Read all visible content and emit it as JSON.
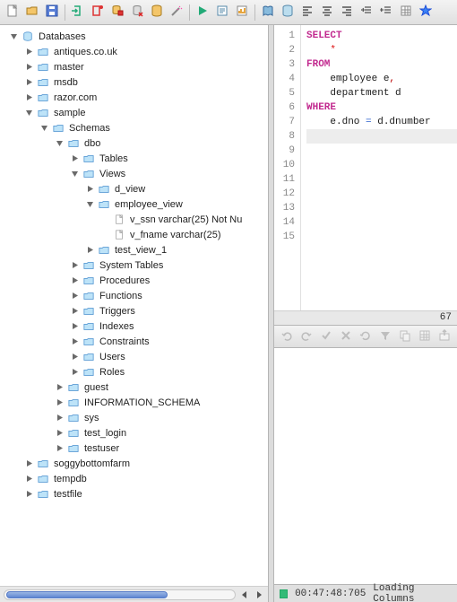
{
  "toolbar": {
    "icons": [
      "new-file-icon",
      "open-icon",
      "save-icon",
      "sep",
      "conn-in-icon",
      "conn-out-icon",
      "db-copy-icon",
      "db-del-icon",
      "db-icon",
      "wand-icon",
      "sep",
      "run-icon",
      "explain-icon",
      "analyze-icon",
      "sep",
      "book-icon",
      "db2-icon",
      "align-left-icon",
      "align-center-icon",
      "align-right-icon",
      "indent-icon",
      "outdent-icon",
      "grid-icon",
      "star-icon"
    ]
  },
  "tree": {
    "root": {
      "label": "Databases",
      "icon": "db-tree-icon",
      "expanded": true,
      "children": [
        {
          "label": "antiques.co.uk",
          "icon": "folder-icon",
          "expanded": false,
          "children": []
        },
        {
          "label": "master",
          "icon": "folder-icon",
          "expanded": false,
          "children": []
        },
        {
          "label": "msdb",
          "icon": "folder-icon",
          "expanded": false,
          "children": []
        },
        {
          "label": "razor.com",
          "icon": "folder-icon",
          "expanded": false,
          "children": []
        },
        {
          "label": "sample",
          "icon": "folder-icon",
          "expanded": true,
          "children": [
            {
              "label": "Schemas",
              "icon": "folder-icon",
              "expanded": true,
              "children": [
                {
                  "label": "dbo",
                  "icon": "folder-icon",
                  "expanded": true,
                  "children": [
                    {
                      "label": "Tables",
                      "icon": "folder-icon",
                      "expanded": false,
                      "children": []
                    },
                    {
                      "label": "Views",
                      "icon": "folder-icon",
                      "expanded": true,
                      "children": [
                        {
                          "label": "d_view",
                          "icon": "folder-icon",
                          "expanded": false,
                          "children": []
                        },
                        {
                          "label": "employee_view",
                          "icon": "folder-icon",
                          "expanded": true,
                          "children": [
                            {
                              "label": "v_ssn varchar(25) Not Nu",
                              "icon": "file-icon",
                              "leaf": true
                            },
                            {
                              "label": "v_fname varchar(25)",
                              "icon": "file-icon",
                              "leaf": true
                            }
                          ]
                        },
                        {
                          "label": "test_view_1",
                          "icon": "folder-icon",
                          "expanded": false,
                          "children": []
                        }
                      ]
                    },
                    {
                      "label": "System Tables",
                      "icon": "folder-icon",
                      "expanded": false,
                      "children": []
                    },
                    {
                      "label": "Procedures",
                      "icon": "folder-icon",
                      "expanded": false,
                      "children": []
                    },
                    {
                      "label": "Functions",
                      "icon": "folder-icon",
                      "expanded": false,
                      "children": []
                    },
                    {
                      "label": "Triggers",
                      "icon": "folder-icon",
                      "expanded": false,
                      "children": []
                    },
                    {
                      "label": "Indexes",
                      "icon": "folder-icon",
                      "expanded": false,
                      "children": []
                    },
                    {
                      "label": "Constraints",
                      "icon": "folder-icon",
                      "expanded": false,
                      "children": []
                    },
                    {
                      "label": "Users",
                      "icon": "folder-icon",
                      "expanded": false,
                      "children": []
                    },
                    {
                      "label": "Roles",
                      "icon": "folder-icon",
                      "expanded": false,
                      "children": []
                    }
                  ]
                },
                {
                  "label": "guest",
                  "icon": "folder-icon",
                  "expanded": false,
                  "children": []
                },
                {
                  "label": "INFORMATION_SCHEMA",
                  "icon": "folder-icon",
                  "expanded": false,
                  "children": []
                },
                {
                  "label": "sys",
                  "icon": "folder-icon",
                  "expanded": false,
                  "children": []
                },
                {
                  "label": "test_login",
                  "icon": "folder-icon",
                  "expanded": false,
                  "children": []
                },
                {
                  "label": "testuser",
                  "icon": "folder-icon",
                  "expanded": false,
                  "children": []
                }
              ]
            }
          ]
        },
        {
          "label": "soggybottomfarm",
          "icon": "folder-icon",
          "expanded": false,
          "children": []
        },
        {
          "label": "tempdb",
          "icon": "folder-icon",
          "expanded": false,
          "children": []
        },
        {
          "label": "testfile",
          "icon": "folder-icon",
          "expanded": false,
          "children": []
        }
      ]
    }
  },
  "editor": {
    "line_count": 15,
    "highlight_line": 8,
    "column_indicator": "67",
    "lines": [
      [
        {
          "cls": "kw",
          "t": "SELECT"
        }
      ],
      [
        {
          "cls": "",
          "t": "    "
        },
        {
          "cls": "star",
          "t": "*"
        }
      ],
      [
        {
          "cls": "kw",
          "t": "FROM"
        }
      ],
      [
        {
          "cls": "",
          "t": "    "
        },
        {
          "cls": "ident",
          "t": "employee e"
        },
        {
          "cls": "punct",
          "t": ","
        }
      ],
      [
        {
          "cls": "",
          "t": "    "
        },
        {
          "cls": "ident",
          "t": "department d"
        }
      ],
      [
        {
          "cls": "kw",
          "t": "WHERE"
        }
      ],
      [
        {
          "cls": "",
          "t": "    "
        },
        {
          "cls": "ident",
          "t": "e.dno "
        },
        {
          "cls": "op",
          "t": "="
        },
        {
          "cls": "ident",
          "t": " d.dnumber"
        }
      ],
      [
        {
          "cls": "",
          "t": " "
        }
      ],
      [],
      [],
      [],
      [],
      [],
      [],
      []
    ]
  },
  "mid_toolbar": {
    "icons": [
      "undo-icon",
      "redo-icon",
      "commit-icon",
      "rollback-icon",
      "refresh-icon",
      "filter-icon",
      "copy-icon",
      "grid-icon",
      "export-icon"
    ]
  },
  "status": {
    "time": "00:47:48:705",
    "text": "Loading Columns"
  }
}
